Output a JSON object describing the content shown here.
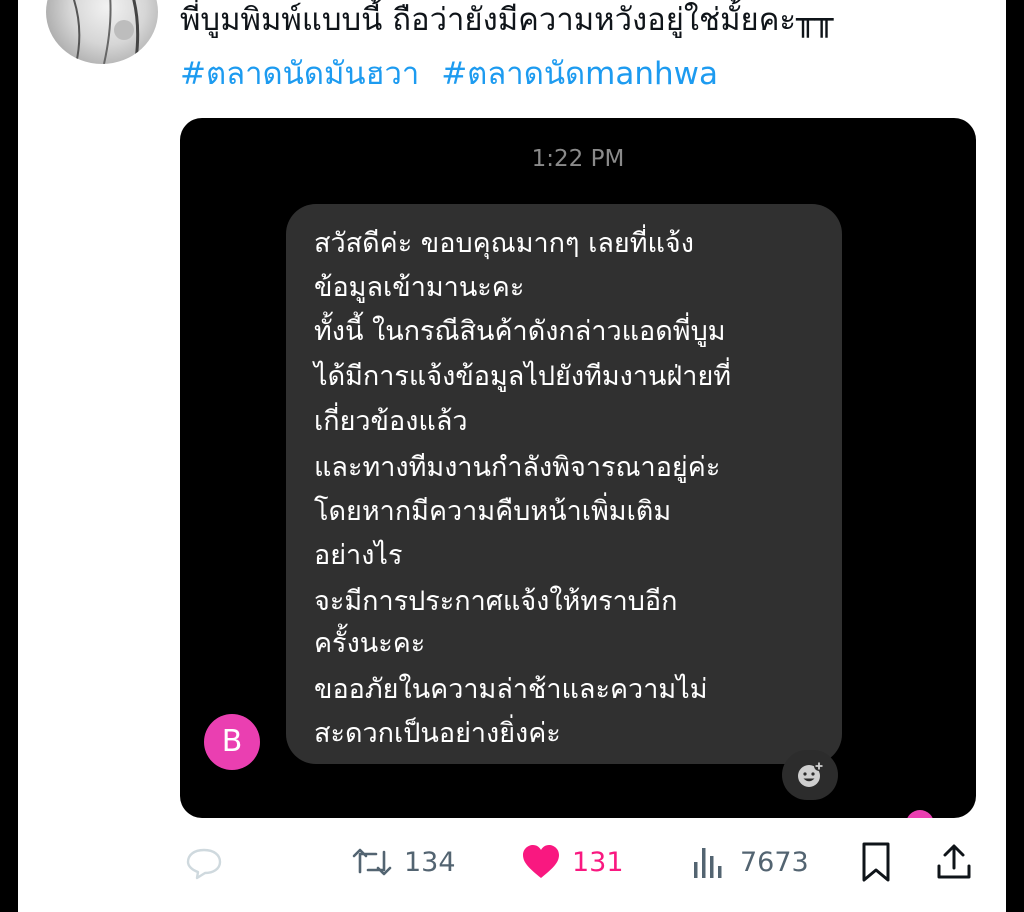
{
  "tweet": {
    "text": "พี่บูมพิมพ์แบบนี้ ถือว่ายังมีความหวังอยู่ใช่มั้ยคะ╥╥",
    "hashtags": [
      "#ตลาดนัดมันฮวา",
      "#ตลาดนัดmanhwa"
    ]
  },
  "chat": {
    "timestamp": "1:22 PM",
    "sender_initial": "B",
    "message_lines": [
      "สวัสดีค่ะ ขอบคุณมากๆ เลยที่แจ้ง",
      "ข้อมูลเข้ามานะคะ",
      "ทั้งนี้ ในกรณีสินค้าดังกล่าวแอดพี่บูม",
      "ได้มีการแจ้งข้อมูลไปยังทีมงานฝ่ายที่",
      "เกี่ยวข้องแล้ว",
      "และทางทีมงานกำลังพิจารณาอยู่ค่ะ",
      "โดยหากมีความคืบหน้าเพิ่มเติม",
      "อย่างไร",
      "จะมีการประกาศแจ้งให้ทราบอีก",
      "ครั้งนะคะ",
      "ขออภัยในความล่าช้าและความไม่",
      "สะดวกเป็นอย่างยิ่งค่ะ"
    ]
  },
  "actions": {
    "reply_icon": "reply-icon",
    "retweets": "134",
    "likes": "131",
    "views": "7673",
    "bookmark_icon": "bookmark-icon",
    "share_icon": "share-icon"
  },
  "colors": {
    "hashtag": "#1d9bf0",
    "like": "#f91880",
    "sender_avatar": "#ea3fb1",
    "bubble": "#303030"
  }
}
